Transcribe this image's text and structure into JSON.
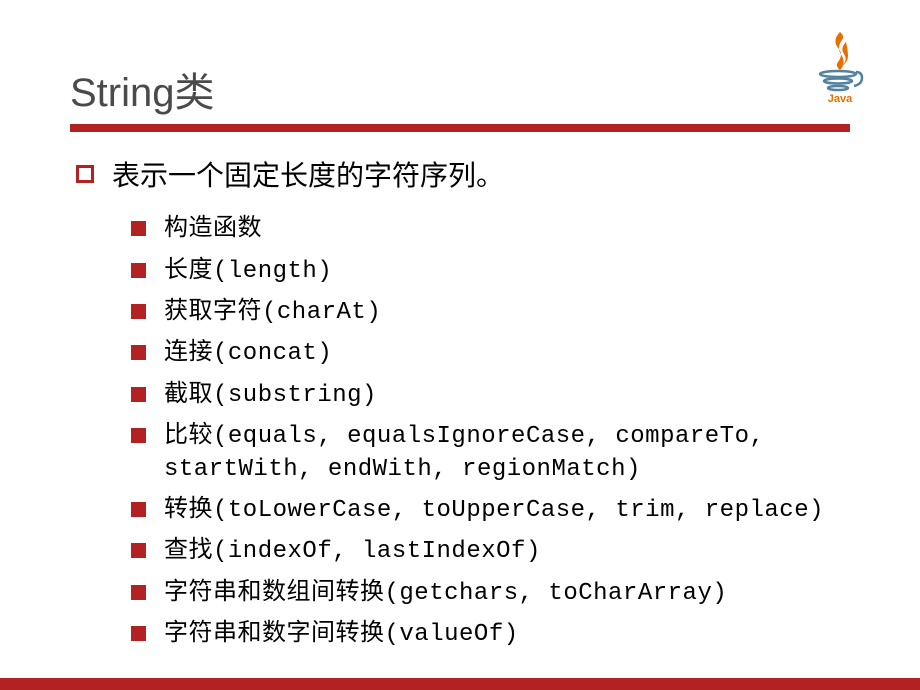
{
  "title": "String类",
  "mainPoint": "表示一个固定长度的字符序列。",
  "subItems": [
    "构造函数",
    "长度(length)",
    "获取字符(charAt)",
    "连接(concat)",
    "截取(substring)",
    "比较(equals, equalsIgnoreCase, compareTo, startWith, endWith, regionMatch)",
    "转换(toLowerCase, toUpperCase, trim, replace)",
    "查找(indexOf, lastIndexOf)",
    "字符串和数组间转换(getchars, toCharArray)",
    "字符串和数字间转换(valueOf)"
  ],
  "logoName": "java-logo"
}
